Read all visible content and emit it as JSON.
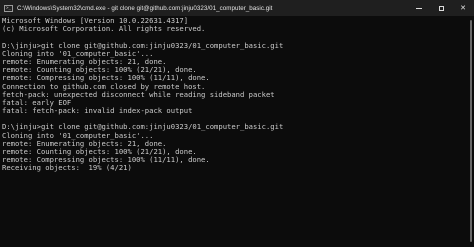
{
  "window": {
    "title": "C:\\Windows\\System32\\cmd.exe - git  clone git@github.com:jinju0323/01_computer_basic.git",
    "icon": "terminal-icon",
    "controls": {
      "minimize": "minimize-icon",
      "maximize": "maximize-icon",
      "close": "close-icon",
      "close_glyph": "✕"
    },
    "icon_prompt": ">_"
  },
  "console": {
    "background": "#0c0c0c",
    "foreground": "#cccccc",
    "lines": [
      "Microsoft Windows [Version 10.0.22631.4317]",
      "(c) Microsoft Corporation. All rights reserved.",
      "",
      "D:\\jinju>git clone git@github.com:jinju0323/01_computer_basic.git",
      "Cloning into '01_computer_basic'...",
      "remote: Enumerating objects: 21, done.",
      "remote: Counting objects: 100% (21/21), done.",
      "remote: Compressing objects: 100% (11/11), done.",
      "Connection to github.com closed by remote host.",
      "fetch-pack: unexpected disconnect while reading sideband packet",
      "fatal: early EOF",
      "fatal: fetch-pack: invalid index-pack output",
      "",
      "D:\\jinju>git clone git@github.com:jinju0323/01_computer_basic.git",
      "Cloning into '01_computer_basic'...",
      "remote: Enumerating objects: 21, done.",
      "remote: Counting objects: 100% (21/21), done.",
      "remote: Compressing objects: 100% (11/11), done.",
      "Receiving objects:  19% (4/21)"
    ]
  }
}
